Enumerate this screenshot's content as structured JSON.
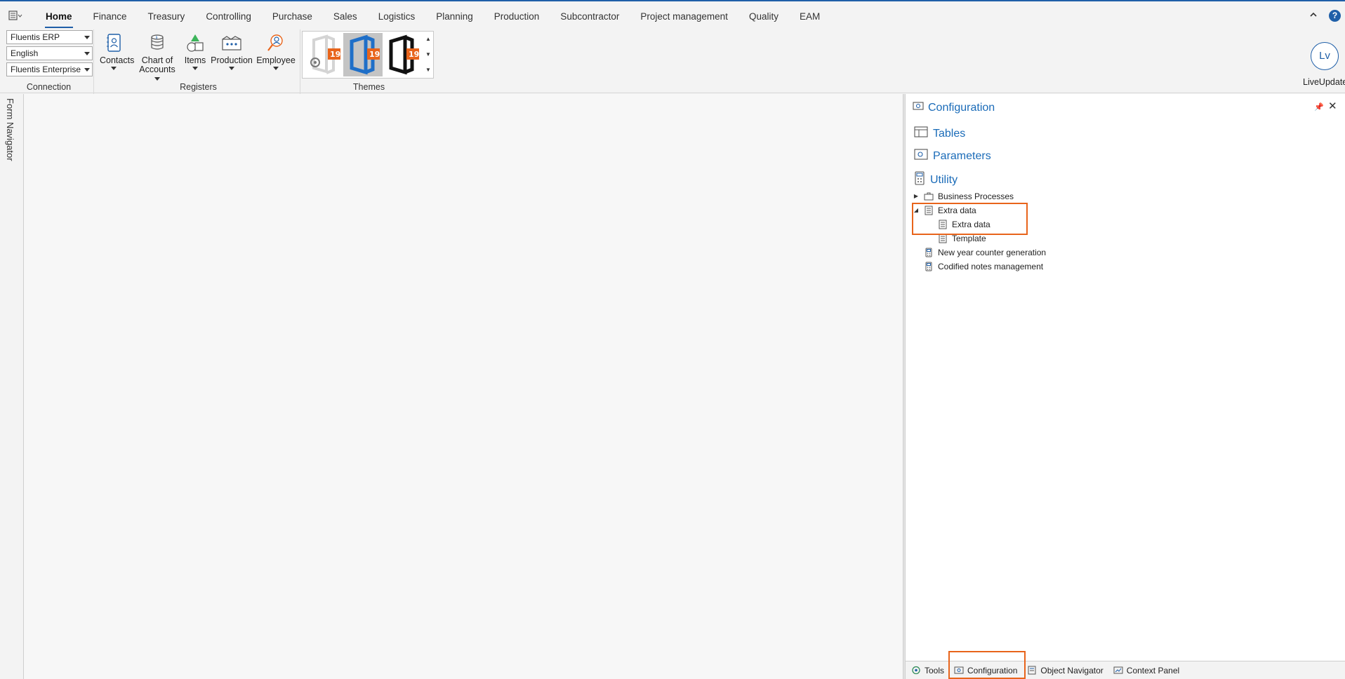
{
  "ribbon": {
    "tabs": [
      {
        "label": "Home",
        "active": true
      },
      {
        "label": "Finance"
      },
      {
        "label": "Treasury"
      },
      {
        "label": "Controlling"
      },
      {
        "label": "Purchase"
      },
      {
        "label": "Sales"
      },
      {
        "label": "Logistics"
      },
      {
        "label": "Planning"
      },
      {
        "label": "Production"
      },
      {
        "label": "Subcontractor"
      },
      {
        "label": "Project management"
      },
      {
        "label": "Quality"
      },
      {
        "label": "EAM"
      }
    ],
    "help_label": "?",
    "connection": {
      "group_label": "Connection",
      "database": "Fluentis ERP",
      "language": "English",
      "company": "Fluentis Enterprise"
    },
    "registers": {
      "group_label": "Registers",
      "contacts": "Contacts",
      "chart_of_accounts_1": "Chart of",
      "chart_of_accounts_2": "Accounts",
      "items": "Items",
      "production": "Production",
      "employee": "Employee"
    },
    "themes": {
      "group_label": "Themes",
      "badge": "19"
    },
    "liveupdate": {
      "initials": "Lv",
      "label": "LiveUpdate"
    }
  },
  "left_nav": {
    "label": "Form Navigator"
  },
  "config_panel": {
    "title": "Configuration",
    "sections": {
      "tables": "Tables",
      "parameters": "Parameters",
      "utility": "Utility"
    },
    "tree": {
      "business_processes": "Business Processes",
      "extra_data": "Extra data",
      "extra_data_child": "Extra data",
      "template": "Template",
      "new_year_counter": "New year counter generation",
      "codified_notes": "Codified notes management"
    }
  },
  "bottom_tabs": {
    "tools": "Tools",
    "configuration": "Configuration",
    "object_navigator": "Object Navigator",
    "context_panel": "Context Panel"
  },
  "colors": {
    "accent": "#1f5fa8",
    "link": "#1a6bb8",
    "highlight": "#e8641b"
  }
}
